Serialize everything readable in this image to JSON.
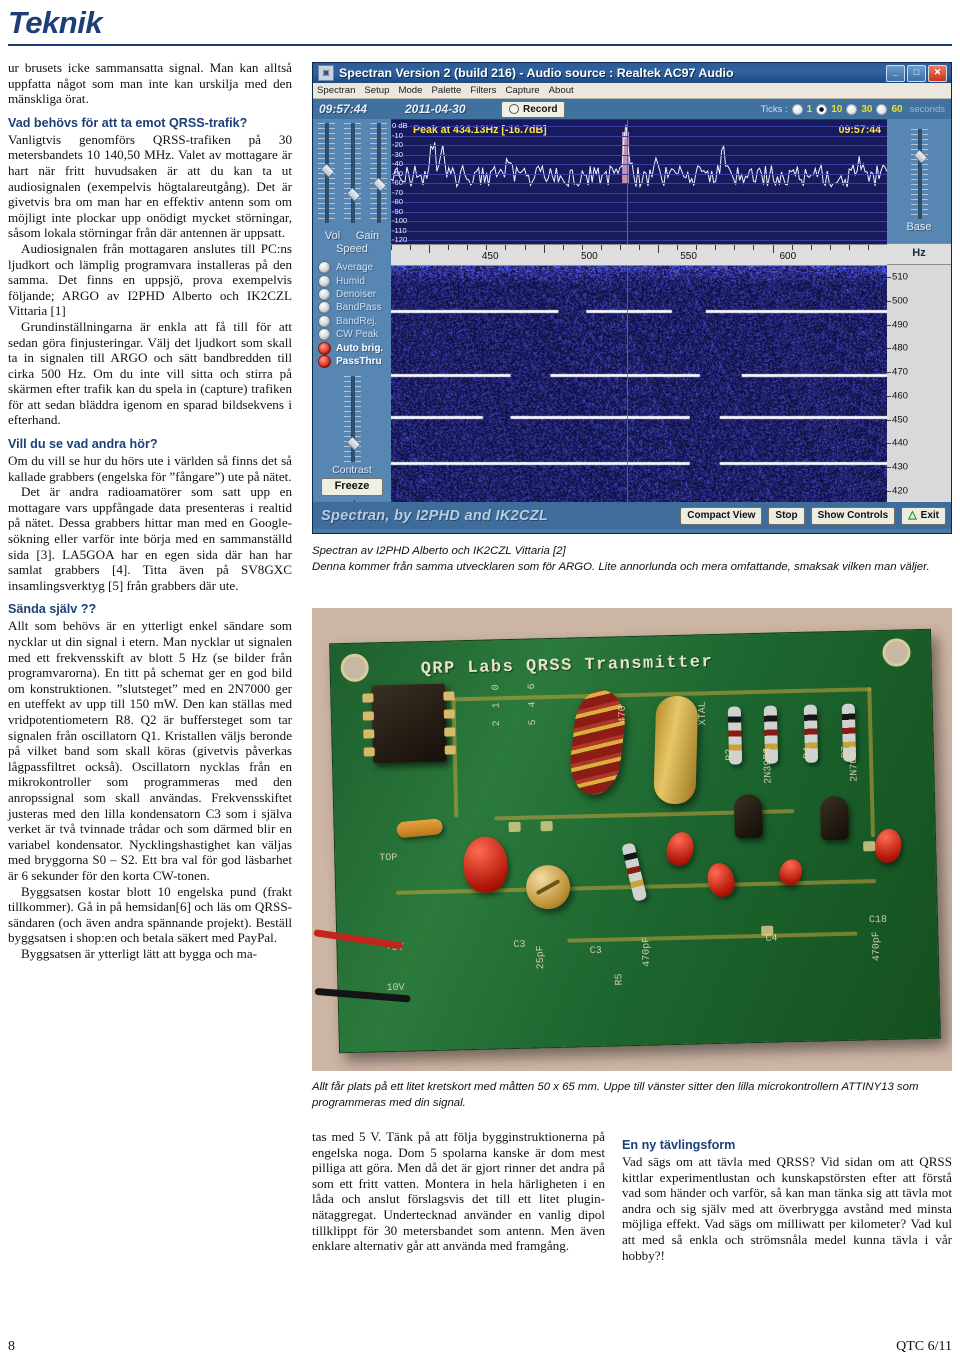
{
  "header": {
    "title": "Teknik"
  },
  "left_column": {
    "paragraphs": [
      {
        "type": "body",
        "indent": false,
        "text": "ur brusets icke sammansatta signal. Man kan alltså uppfatta något som man inte kan urskilja med den mänskliga örat."
      },
      {
        "type": "heading",
        "text": "Vad behövs för att ta emot QRSS-trafik?"
      },
      {
        "type": "body",
        "indent": false,
        "text": "Vanligtvis genomförs QRSS-trafiken på 30 metersbandets 10 140,50 MHz. Valet av mottagare är hart när fritt huvudsaken är att du kan ta ut audiosignalen (exempelvis högtalareutgång). Det är givetvis bra om man har en effektiv antenn som om möjligt inte plockar upp onödigt mycket störningar, såsom lokala störningar från där antennen är uppsatt."
      },
      {
        "type": "body",
        "indent": true,
        "text": "Audiosignalen från mottagaren anslutes till PC:ns ljudkort och lämplig programvara installeras på den samma. Det finns en uppsjö, prova exempelvis följande; ARGO av I2PHD Alberto och IK2CZL Vittaria [1]"
      },
      {
        "type": "body",
        "indent": true,
        "text": "Grundinställningarna är enkla att få till för att sedan göra finjusteringar. Välj det ljudkort som skall ta in signalen till ARGO och sätt bandbredden till cirka 500 Hz. Om du inte vill sitta och stirra på skärmen efter trafik kan du spela in (capture) trafiken för att sedan bläddra igenom en sparad bildsekvens i efterhand."
      },
      {
        "type": "heading",
        "text": "Vill du se  vad andra hör?"
      },
      {
        "type": "body",
        "indent": false,
        "text": "Om du vill se hur du hörs ute i världen så finns det så kallade grabbers (engelska för ”fångare”) ute på nätet."
      },
      {
        "type": "body",
        "indent": true,
        "text": "Det är andra radioamatörer som satt upp en mottagare vars uppfångade data presenteras i realtid på nätet. Dessa grabbers hittar man med en Google-sökning eller varför inte börja med en sammanställd sida [3]. LA5GOA har en egen sida där han har samlat grabbers [4]. Titta även på SV8GXC insamlingsverktyg [5] från grabbers där ute."
      },
      {
        "type": "heading",
        "text": "Sända själv ??"
      },
      {
        "type": "body",
        "indent": false,
        "text": "Allt som behövs är en ytterligt enkel sändare som nycklar ut din signal i etern. Man nycklar ut signalen med ett frekvensskift av blott 5 Hz (se bilder från programvarorna). En titt på schemat ger en god bild om konstruktionen. ”slutsteget” med en 2N7000 ger en uteffekt av upp till 150 mW. Den kan ställas med vridpotentiometern R8. Q2 är buffersteget som tar signalen från oscillatorn Q1. Kristallen väljs beronde på vilket band som skall köras (givetvis påverkas lågpassfiltret också). Oscillatorn nycklas från en mikrokontroller som programmeras med den anropssignal som skall användas. Frekvensskiftet justeras med den lilla kondensatorn C3 som i själva verket är två tvinnade trådar och som därmed blir en variabel kondensator. Nycklingshastighet kan väljas med bryggorna S0 – S2. Ett bra val för god läsbarhet är 6 sekunder för den korta CW-tonen."
      },
      {
        "type": "body",
        "indent": true,
        "text": "Byggsatsen kostar blott 10 engelska pund (frakt tillkommer). Gå in på hemsidan[6] och läs om QRSS-sändaren (och även andra spännande projekt). Beställ byggsatsen i shop:en och betala säkert med PayPal."
      },
      {
        "type": "body",
        "indent": true,
        "text": "Byggsatsen är ytterligt lätt att bygga och ma-"
      }
    ]
  },
  "bottom_column_1": {
    "paragraphs": [
      {
        "type": "body",
        "indent": false,
        "text": "tas med 5 V. Tänk på att följa bygginstruktionerna på engelska noga. Dom 5 spolarna kanske är dom mest pilliga att göra. Men då det är gjort rinner det andra på som ett fritt vatten. Montera in hela härligheten i en låda och anslut förslagsvis det till ett litet plugin-nätaggregat. Undertecknad använder en vanlig dipol tillklippt för 30 metersbandet som antenn. Men även enklare alternativ går att använda med framgång."
      }
    ]
  },
  "bottom_column_2": {
    "paragraphs": [
      {
        "type": "heading",
        "text": "En ny tävlingsform"
      },
      {
        "type": "body",
        "indent": false,
        "text": "Vad sägs om att tävla med QRSS? Vid sidan om att QRSS kittlar experimentlustan och kunskapstörsten efter att förstå vad som händer och varför, så kan man tänka sig att tävla mot andra och sig själv med att överbrygga avstånd med minsta möjliga effekt. Vad sägs om milliwatt per kilometer? Vad kul att med så enkla och strömsnåla medel kunna tävla i vår hobby?!"
      }
    ]
  },
  "captions": {
    "spectran": "Spectran av I2PHD Alberto och IK2CZL Vittaria [2]\nDenna kommer från samma utvecklaren som för ARGO. Lite annorlunda och mera omfattande, smaksak vilken man väljer.",
    "pcb": "Allt får plats på ett litet kretskort med måtten 50 x 65 mm. Uppe till vänster sitter den lilla microkontrollern ATTINY13 som programmeras med din signal."
  },
  "spectran": {
    "title": "Spectran Version 2 (build 216) - Audio source  :  Realtek AC97 Audio",
    "window_buttons": {
      "minimize": "_",
      "maximize": "□",
      "close": "✕"
    },
    "menu": [
      "Spectran",
      "Setup",
      "Mode",
      "Palette",
      "Filters",
      "Capture",
      "About"
    ],
    "toolbar": {
      "time": "09:57:44",
      "date": "2011-04-30",
      "record_label": "Record",
      "ticks_label": "Ticks :",
      "ticks_options": [
        "1",
        "10",
        "30",
        "60"
      ],
      "ticks_selected": "10",
      "ticks_unit": "seconds"
    },
    "controls": {
      "slider_labels": [
        "Vol",
        "Gain"
      ],
      "speed_label": "Speed",
      "checkboxes": [
        {
          "label": "Average",
          "on": false
        },
        {
          "label": "Humid",
          "on": false
        },
        {
          "label": "Denoiser",
          "on": false
        },
        {
          "label": "BandPass",
          "on": false
        },
        {
          "label": "BandRej.",
          "on": false
        },
        {
          "label": "CW Peak",
          "on": false
        },
        {
          "label": "Auto brig.",
          "on": true
        },
        {
          "label": "PassThru",
          "on": true
        }
      ],
      "contrast_label": "Contrast",
      "freeze_label": "Freeze"
    },
    "spectrum": {
      "peak_text": "Peak at  434.13Hz [-16.7dB]",
      "clock": "09:57:44",
      "db_labels": [
        "0 dB",
        "-10",
        "-20",
        "-30",
        "-40",
        "-50",
        "-60",
        "-70",
        "-80",
        "-90",
        "-100",
        "-110",
        "-120"
      ]
    },
    "freq_axis": {
      "labels": [
        "450",
        "500",
        "550",
        "600"
      ],
      "unit": "Hz"
    },
    "hz_scale": [
      "510",
      "500",
      "490",
      "480",
      "470",
      "460",
      "450",
      "440",
      "430",
      "420"
    ],
    "base_label": "Base",
    "statusbar": {
      "brand": "Spectran, by I2PHD and IK2CZL",
      "buttons": [
        "Compact View",
        "Stop",
        "Show Controls",
        "Exit"
      ]
    }
  },
  "pcb": {
    "silkscreen_title": "QRP Labs QRSS Transmitter"
  },
  "footer": {
    "page": "8",
    "issue": "QTC 6/11"
  }
}
